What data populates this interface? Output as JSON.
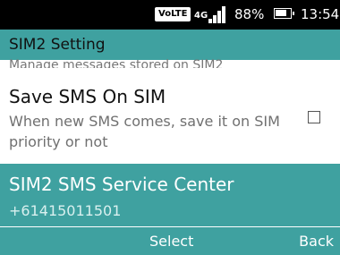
{
  "status_bar": {
    "volte_label": "VoLTE",
    "network_type": "4G",
    "battery_percent": "88%",
    "battery_level": 0.88,
    "time": "13:54"
  },
  "header": {
    "title": "SIM2 Setting"
  },
  "list": {
    "clipped_summary": "Manage messages stored on SIM2",
    "save_sms_on_sim": {
      "title": "Save SMS On SIM",
      "summary": "When new SMS comes, save it on SIM priority or not",
      "checked": false
    },
    "sms_service_center": {
      "title": "SIM2 SMS Service Center",
      "value": "+61415011501"
    }
  },
  "softkeys": {
    "center": "Select",
    "right": "Back"
  },
  "colors": {
    "accent": "#3fa1a0",
    "status_bar_bg": "#000000"
  }
}
